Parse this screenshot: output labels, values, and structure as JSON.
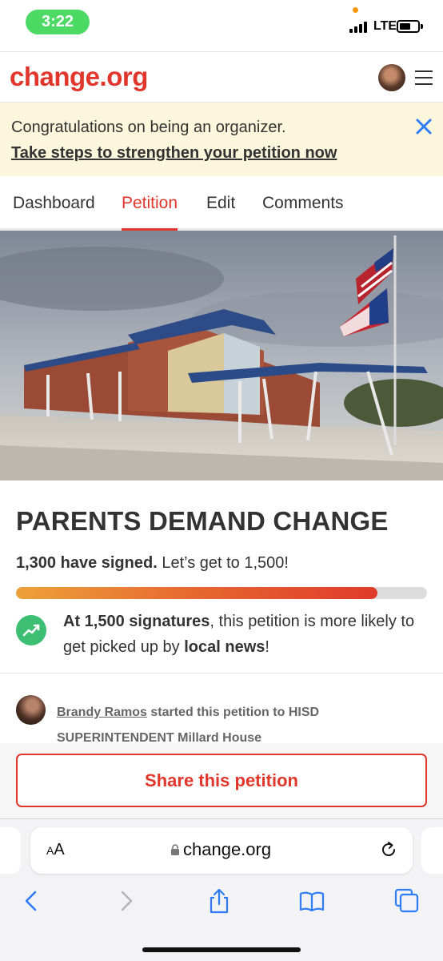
{
  "status_bar": {
    "time": "3:22",
    "network": "LTE"
  },
  "header": {
    "logo": "change.org"
  },
  "banner": {
    "message": "Congratulations on being an organizer.",
    "link": "Take steps to strengthen your petition now"
  },
  "tabs": [
    {
      "label": "Dashboard",
      "active": false
    },
    {
      "label": "Petition",
      "active": true
    },
    {
      "label": "Edit",
      "active": false
    },
    {
      "label": "Comments",
      "active": false
    }
  ],
  "petition": {
    "title": "PARENTS DEMAND CHANGE",
    "signed_count": "1,300 have signed.",
    "goal_text": "Let’s get to 1,500!",
    "progress_fraction": 0.88,
    "milestone_bold": "At 1,500 signatures",
    "milestone_text": ", this petition is more likely to get picked up by ",
    "milestone_bold2": "local news",
    "milestone_end": "!",
    "starter_name": "Brandy Ramos",
    "starter_text": " started this petition to HISD SUPERINTENDENT Millard House"
  },
  "share": {
    "label": "Share this petition"
  },
  "browser": {
    "aa_label_small": "A",
    "aa_label_large": "A",
    "url": "change.org"
  },
  "colors": {
    "brand": "#e0362b",
    "banner_bg": "#fbf6dc",
    "success": "#3cbf72",
    "ios_blue": "#2f7cf6"
  }
}
